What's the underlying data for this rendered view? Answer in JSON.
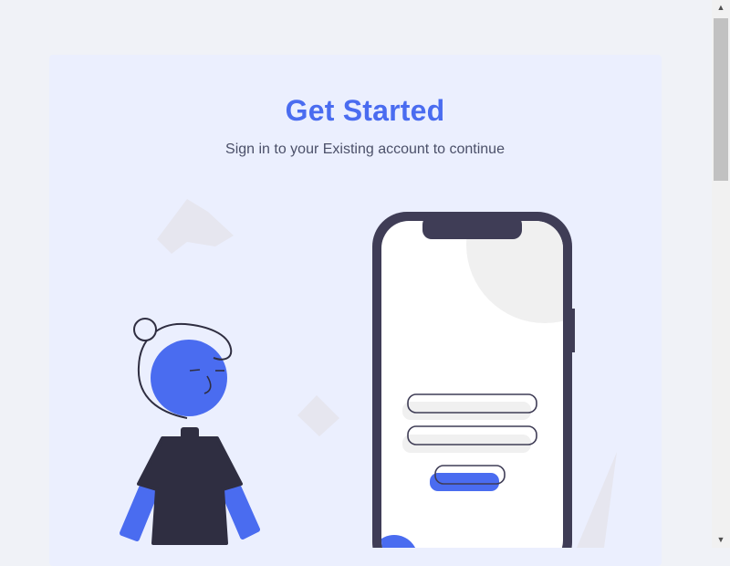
{
  "header": {
    "title": "Get Started",
    "subtitle": "Sign in to your Existing account to continue"
  },
  "icons": {
    "scroll_up": "▲",
    "scroll_down": "▼"
  },
  "colors": {
    "accent": "#4a6cf0",
    "phone_frame": "#3f3d56",
    "card_bg": "#ebeffe",
    "page_bg": "#f0f2f7"
  }
}
